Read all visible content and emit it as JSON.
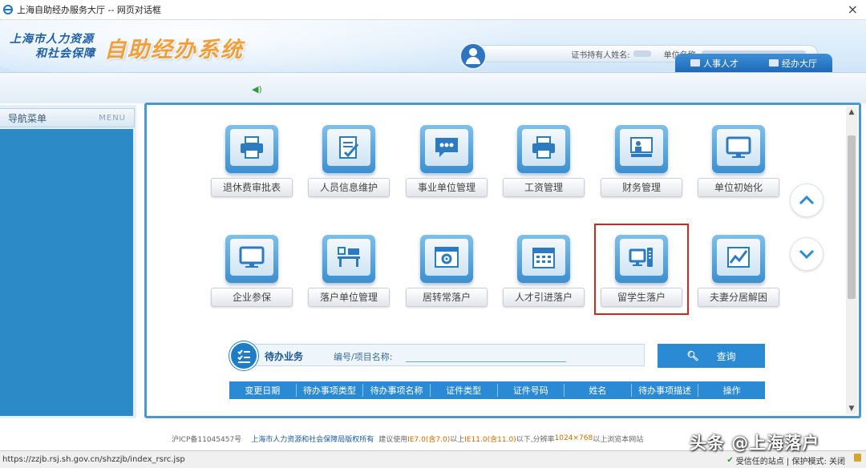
{
  "window": {
    "title": "上海自助经办服务大厅 -- 网页对话框",
    "close_label": "×"
  },
  "banner": {
    "logo_line1": "上海市人力资源",
    "logo_line2": "和社会保障",
    "system_title": "自助经办系统",
    "cert_holder_label": "证书持有人姓名:",
    "unit_label": "单位名称:"
  },
  "top_nav": [
    {
      "label": "人事人才",
      "icon": "monitor-icon"
    },
    {
      "label": "经办大厅",
      "icon": "building-icon"
    }
  ],
  "sidebar": {
    "title": "导航菜单",
    "menu_label": "MENU"
  },
  "tiles": [
    {
      "label": "退休费审批表",
      "icon": "printer-icon"
    },
    {
      "label": "人员信息维护",
      "icon": "document-edit-icon"
    },
    {
      "label": "事业单位管理",
      "icon": "chat-bubble-icon"
    },
    {
      "label": "工资管理",
      "icon": "printer-icon"
    },
    {
      "label": "财务管理",
      "icon": "presentation-icon"
    },
    {
      "label": "单位初始化",
      "icon": "monitor-icon"
    },
    {
      "label": "企业参保",
      "icon": "monitor-icon"
    },
    {
      "label": "落户单位管理",
      "icon": "desk-icon"
    },
    {
      "label": "居转常落户",
      "icon": "settings-window-icon"
    },
    {
      "label": "人才引进落户",
      "icon": "calendar-icon"
    },
    {
      "label": "留学生落户",
      "icon": "desktop-computer-icon"
    },
    {
      "label": "夫妻分居解困",
      "icon": "chart-icon"
    }
  ],
  "todo": {
    "title": "待办业务",
    "search_label": "编号/项目名称:",
    "search_value": "",
    "search_button": "查询"
  },
  "table": {
    "headers": [
      "变更日期",
      "待办事项类型",
      "待办事项名称",
      "证件类型",
      "证件号码",
      "姓名",
      "待办事项描述",
      "操作"
    ]
  },
  "footer": {
    "icp": "沪ICP备11045457号",
    "copyright": "上海市人力资源和社会保障局版权所有",
    "suggest": "建议使用",
    "ie7": "IE7.0(含7.0)",
    "above": "以上",
    "ie11": "IE11.0(含11.0)",
    "resolution_prefix": "以下,分辨率",
    "resolution": "1024×768",
    "resolution_suffix": "以上浏览本网站"
  },
  "status_bar": {
    "url": "https://zzjb.rsj.sh.gov.cn/shzzjb/index_rsrc.jsp",
    "trusted": "受信任的站点 | 保护模式: 关闭"
  },
  "watermark": "头条 @上海落户",
  "colors": {
    "accent": "#2a8ad4",
    "highlight": "#d9231d",
    "logo_orange": "#f0a03a"
  }
}
